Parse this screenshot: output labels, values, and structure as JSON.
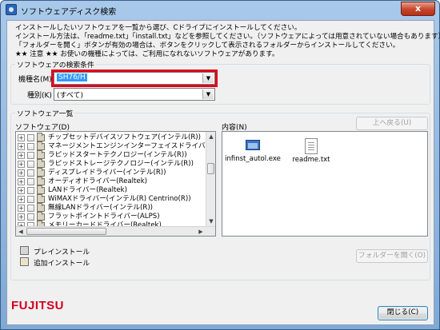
{
  "window": {
    "title": "ソフトウェアディスク検索",
    "close_label": "x"
  },
  "intro": [
    "インストールしたいソフトウェアを一覧から選び、Cドライブにインストールしてください。",
    "インストール方法は、「readme.txt」「install.txt」などを参照してください。（ソフトウェアによっては用意されていない場合もあります）",
    "「フォルダーを開く」ボタンが有効の場合は、ボタンをクリックして表示されるフォルダーからインストールしてください。",
    "★★ 注意 ★★ お使いの機種によっては、ご利用になれないソフトウェアがあります。"
  ],
  "search": {
    "group_title": "ソフトウェアの検索条件",
    "model_label": "機種名(M)",
    "model_value": "SH76/H",
    "type_label": "種別(K)",
    "type_value": "(すべて)"
  },
  "list": {
    "group_title": "ソフトウェア一覧",
    "software_label": "ソフトウェア(D)",
    "content_label": "内容(N)",
    "up_button": "上へ戻る(U)",
    "open_folder_button": "フォルダーを開く(O)",
    "items": [
      "チップセットデバイスソフトウェア(インテル(R))",
      "マネージメントエンジンインターフェイスドライバー(インテル",
      "ラピッドスタートテクノロジー(インテル(R))",
      "ラピッドストレージテクノロジー(インテル(R))",
      "ディスプレイドライバー(インテル(R))",
      "オーディオドライバー(Realtek)",
      "LANドライバー(Realtek)",
      "WiMAXドライバー(インテル(R) Centrino(R))",
      "無線LANドライバー(インテル(R))",
      "フラットポイントドライバー(ALPS)",
      "メモリーカードドライバー(Realtek)"
    ],
    "files": [
      {
        "name": "infinst_autol.exe",
        "icon": "exe-icon"
      },
      {
        "name": "readme.txt",
        "icon": "text-file-icon"
      }
    ]
  },
  "legend": {
    "preinstall": "プレインストール",
    "additional": "追加インストール"
  },
  "footer": {
    "logo": "FUJITSU",
    "close_button": "閉じる(C)"
  },
  "colors": {
    "highlight": "#e0001b",
    "selection": "#3399ff",
    "brand": "#d2001f"
  }
}
